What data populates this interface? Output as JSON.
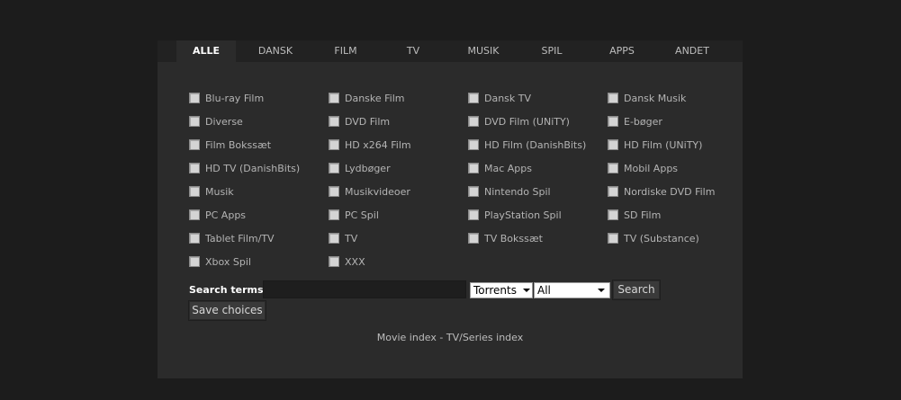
{
  "tabs": [
    {
      "label": "ALLE",
      "active": true
    },
    {
      "label": "DANSK",
      "active": false
    },
    {
      "label": "FILM",
      "active": false
    },
    {
      "label": "TV",
      "active": false
    },
    {
      "label": "MUSIK",
      "active": false
    },
    {
      "label": "SPIL",
      "active": false
    },
    {
      "label": "APPS",
      "active": false
    },
    {
      "label": "ANDET",
      "active": false
    }
  ],
  "categories": [
    {
      "label": "Blu-ray Film",
      "checked": false
    },
    {
      "label": "Danske Film",
      "checked": false
    },
    {
      "label": "Dansk TV",
      "checked": false
    },
    {
      "label": "Dansk Musik",
      "checked": false
    },
    {
      "label": "Diverse",
      "checked": false
    },
    {
      "label": "DVD Film",
      "checked": false
    },
    {
      "label": "DVD Film (UNiTY)",
      "checked": false
    },
    {
      "label": "E-bøger",
      "checked": false
    },
    {
      "label": "Film Bokssæt",
      "checked": false
    },
    {
      "label": "HD x264 Film",
      "checked": false
    },
    {
      "label": "HD Film (DanishBits)",
      "checked": false
    },
    {
      "label": "HD Film (UNiTY)",
      "checked": false
    },
    {
      "label": "HD TV (DanishBits)",
      "checked": false
    },
    {
      "label": "Lydbøger",
      "checked": false
    },
    {
      "label": "Mac Apps",
      "checked": false
    },
    {
      "label": "Mobil Apps",
      "checked": false
    },
    {
      "label": "Musik",
      "checked": false
    },
    {
      "label": "Musikvideoer",
      "checked": false
    },
    {
      "label": "Nintendo Spil",
      "checked": false
    },
    {
      "label": "Nordiske DVD Film",
      "checked": false
    },
    {
      "label": "PC Apps",
      "checked": false
    },
    {
      "label": "PC Spil",
      "checked": false
    },
    {
      "label": "PlayStation Spil",
      "checked": false
    },
    {
      "label": "SD Film",
      "checked": false
    },
    {
      "label": "Tablet Film/TV",
      "checked": false
    },
    {
      "label": "TV",
      "checked": false
    },
    {
      "label": "TV Bokssæt",
      "checked": false
    },
    {
      "label": "TV (Substance)",
      "checked": false
    },
    {
      "label": "Xbox Spil",
      "checked": false
    },
    {
      "label": "XXX",
      "checked": false
    }
  ],
  "search": {
    "label": "Search terms:",
    "value": "",
    "placeholder": "",
    "type_select": "Torrents",
    "scope_select": "All",
    "button_label": "Search",
    "save_label": "Save choices"
  },
  "footer": {
    "movie_index": "Movie index",
    "separator": " - ",
    "tv_index": "TV/Series index"
  },
  "colors": {
    "page_bg": "#1c1c1c",
    "panel_bg": "#2b2b2b",
    "tabbar_bg": "#222222",
    "active_tab_text": "#ffffff",
    "tab_text": "#bdbdbd"
  }
}
